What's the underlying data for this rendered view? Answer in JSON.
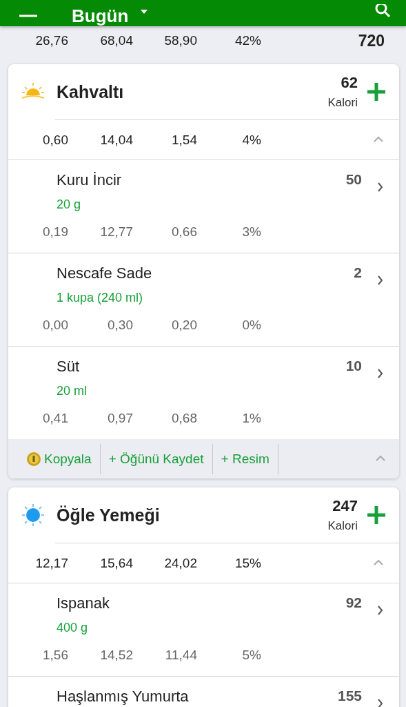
{
  "app_bar": {
    "title": "Bugün"
  },
  "summary": {
    "values": [
      "26,76",
      "68,04",
      "58,90",
      "42%"
    ],
    "calories": "720"
  },
  "meals": [
    {
      "kind": "breakfast",
      "title": "Kahvaltı",
      "calories": "62",
      "calories_label": "Kalori",
      "expanded": true,
      "totals": [
        "0,60",
        "14,04",
        "1,54",
        "4%"
      ],
      "items": [
        {
          "name": "Kuru İncir",
          "amount": "20 g",
          "calories": "50",
          "values": [
            "0,19",
            "12,77",
            "0,66",
            "3%"
          ]
        },
        {
          "name": "Nescafe Sade",
          "amount": "1 kupa (240 ml)",
          "calories": "2",
          "values": [
            "0,00",
            "0,30",
            "0,20",
            "0%"
          ]
        },
        {
          "name": "Süt",
          "amount": "20 ml",
          "calories": "10",
          "values": [
            "0,41",
            "0,97",
            "0,68",
            "1%"
          ]
        }
      ],
      "actions": [
        {
          "kind": "copy",
          "label": "Kopyala"
        },
        {
          "kind": "add",
          "label": "+ Öğünü Kaydet"
        },
        {
          "kind": "add",
          "label": "+ Resim"
        }
      ]
    },
    {
      "kind": "lunch",
      "title": "Öğle Yemeği",
      "calories": "247",
      "calories_label": "Kalori",
      "expanded": true,
      "totals": [
        "12,17",
        "15,64",
        "24,02",
        "15%"
      ],
      "items": [
        {
          "name": "Ispanak",
          "amount": "400 g",
          "calories": "92",
          "values": [
            "1,56",
            "14,52",
            "11,44",
            "5%"
          ]
        },
        {
          "name": "Haşlanmış Yumurta",
          "calories": "155"
        }
      ]
    }
  ]
}
